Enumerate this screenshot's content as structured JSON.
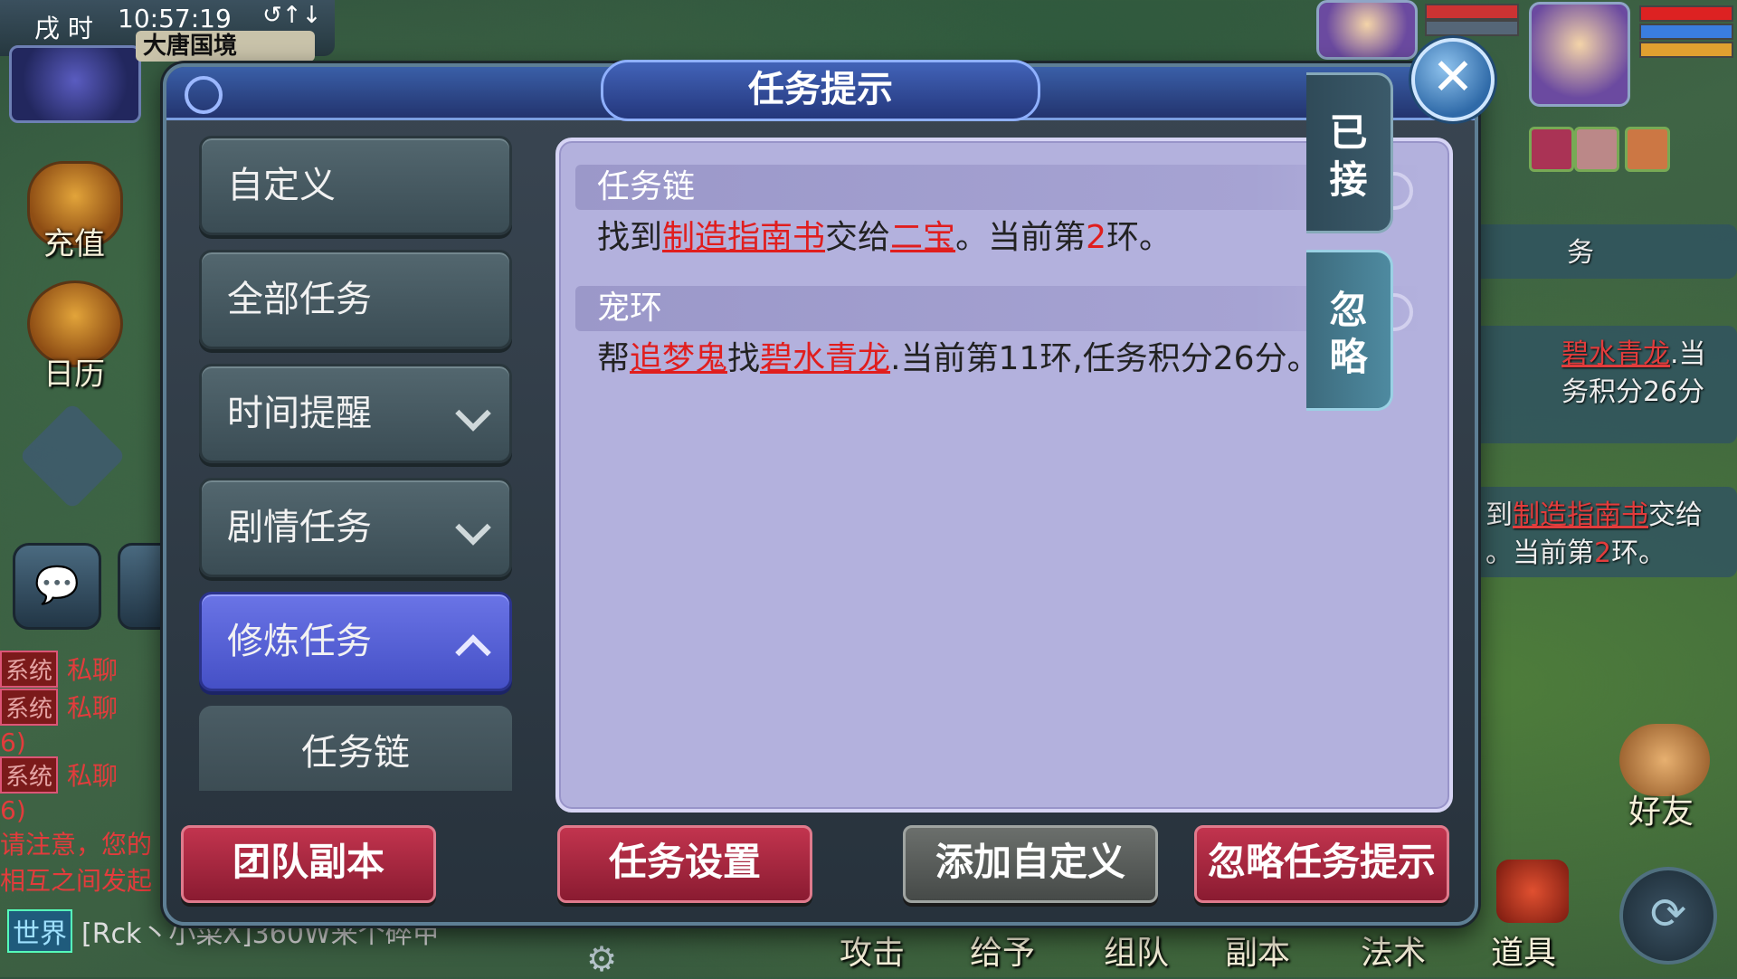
{
  "hud": {
    "shichen": "戌 时",
    "clock": "10:57:19",
    "signal": "↺↑↓",
    "map_name": "大唐国境",
    "left_icons": [
      {
        "label": "充值",
        "icon": "treasure-chest-icon"
      },
      {
        "label": "日历",
        "icon": "calendar-gong-icon"
      }
    ]
  },
  "chat": {
    "rows": [
      {
        "tag": "系统",
        "channel": "私聊"
      },
      {
        "tag": "系统",
        "channel": "私聊"
      },
      {
        "tag": "系统",
        "channel": "私聊"
      }
    ],
    "fragment_a": "6)",
    "fragment_b": "6)",
    "notice_line1": "请注意，您的",
    "notice_line2": "相互之间发起",
    "world_tag": "世界",
    "world_message": "[Rck丶小菜X]360W来个碎甲"
  },
  "background_tracker": {
    "line1_link": "碧水青龙",
    "line1_rest": ".当",
    "line2": "务积分26分",
    "line3_prefix": "到",
    "line3_link": "制造指南书",
    "line3_rest": "交给",
    "line4_prefix": "。当前第",
    "line4_num": "2",
    "line4_rest": "环。",
    "stub": "务"
  },
  "bottom_menu": [
    "攻击",
    "给予",
    "组队",
    "副本",
    "法术",
    "道具"
  ],
  "friend_label": "好友",
  "modal": {
    "title": "任务提示",
    "close": "✕",
    "categories": [
      {
        "label": "自定义",
        "chevron": false
      },
      {
        "label": "全部任务",
        "chevron": false
      },
      {
        "label": "时间提醒",
        "chevron": true
      },
      {
        "label": "剧情任务",
        "chevron": true
      },
      {
        "label": "修炼任务",
        "chevron": true,
        "active": true
      }
    ],
    "subcategory": "任务链",
    "tasks": [
      {
        "header": "任务链",
        "parts": {
          "p1": "找到",
          "link1": "制造指南书",
          "p2": "交给",
          "link2": "二宝",
          "p3": "。当前第",
          "num": "2",
          "p4": "环。"
        }
      },
      {
        "header": "宠环",
        "parts": {
          "p1": "帮",
          "link1": "追梦鬼",
          "p2": "找",
          "link2": "碧水青龙",
          "p3": ".当前第11环,任务积分26分。"
        }
      }
    ],
    "side_tabs": {
      "accepted": [
        "已",
        "接"
      ],
      "ignored": [
        "忽",
        "略"
      ]
    },
    "buttons": {
      "team_dungeon": "团队副本",
      "task_settings": "任务设置",
      "add_custom": "添加自定义",
      "ignore_hint": "忽略任务提示"
    }
  }
}
